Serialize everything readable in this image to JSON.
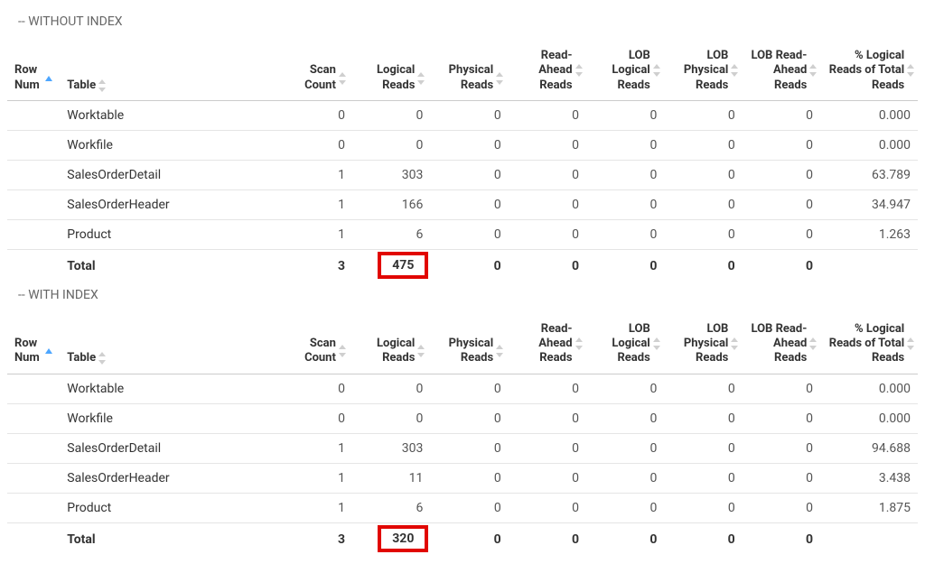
{
  "sections": [
    {
      "title": "-- WITHOUT INDEX",
      "highlightTotal": "475"
    },
    {
      "title": "-- WITH INDEX",
      "highlightTotal": "320"
    }
  ],
  "columns": {
    "rowNum": "Row Num",
    "table": "Table",
    "scanCount": "Scan Count",
    "logicalReads": "Logical Reads",
    "physicalReads": "Physical Reads",
    "readAheadReads": "Read-Ahead Reads",
    "lobLogicalReads": "LOB Logical Reads",
    "lobPhysicalReads": "LOB Physical Reads",
    "lobReadAheadReads": "LOB Read-Ahead Reads",
    "pctLogicalReads": "% Logical Reads of Total Reads"
  },
  "tableData": [
    {
      "rows": [
        {
          "tbl": "Worktable",
          "scan": "0",
          "lreads": "0",
          "preads": "0",
          "rareads": "0",
          "loblr": "0",
          "lobpr": "0",
          "lobra": "0",
          "pct": "0.000"
        },
        {
          "tbl": "Workfile",
          "scan": "0",
          "lreads": "0",
          "preads": "0",
          "rareads": "0",
          "loblr": "0",
          "lobpr": "0",
          "lobra": "0",
          "pct": "0.000"
        },
        {
          "tbl": "SalesOrderDetail",
          "scan": "1",
          "lreads": "303",
          "preads": "0",
          "rareads": "0",
          "loblr": "0",
          "lobpr": "0",
          "lobra": "0",
          "pct": "63.789"
        },
        {
          "tbl": "SalesOrderHeader",
          "scan": "1",
          "lreads": "166",
          "preads": "0",
          "rareads": "0",
          "loblr": "0",
          "lobpr": "0",
          "lobra": "0",
          "pct": "34.947"
        },
        {
          "tbl": "Product",
          "scan": "1",
          "lreads": "6",
          "preads": "0",
          "rareads": "0",
          "loblr": "0",
          "lobpr": "0",
          "lobra": "0",
          "pct": "1.263"
        }
      ],
      "total": {
        "tbl": "Total",
        "scan": "3",
        "lreads": "475",
        "preads": "0",
        "rareads": "0",
        "loblr": "0",
        "lobpr": "0",
        "lobra": "0",
        "pct": ""
      }
    },
    {
      "rows": [
        {
          "tbl": "Worktable",
          "scan": "0",
          "lreads": "0",
          "preads": "0",
          "rareads": "0",
          "loblr": "0",
          "lobpr": "0",
          "lobra": "0",
          "pct": "0.000"
        },
        {
          "tbl": "Workfile",
          "scan": "0",
          "lreads": "0",
          "preads": "0",
          "rareads": "0",
          "loblr": "0",
          "lobpr": "0",
          "lobra": "0",
          "pct": "0.000"
        },
        {
          "tbl": "SalesOrderDetail",
          "scan": "1",
          "lreads": "303",
          "preads": "0",
          "rareads": "0",
          "loblr": "0",
          "lobpr": "0",
          "lobra": "0",
          "pct": "94.688"
        },
        {
          "tbl": "SalesOrderHeader",
          "scan": "1",
          "lreads": "11",
          "preads": "0",
          "rareads": "0",
          "loblr": "0",
          "lobpr": "0",
          "lobra": "0",
          "pct": "3.438"
        },
        {
          "tbl": "Product",
          "scan": "1",
          "lreads": "6",
          "preads": "0",
          "rareads": "0",
          "loblr": "0",
          "lobpr": "0",
          "lobra": "0",
          "pct": "1.875"
        }
      ],
      "total": {
        "tbl": "Total",
        "scan": "3",
        "lreads": "320",
        "preads": "0",
        "rareads": "0",
        "loblr": "0",
        "lobpr": "0",
        "lobra": "0",
        "pct": ""
      }
    }
  ]
}
